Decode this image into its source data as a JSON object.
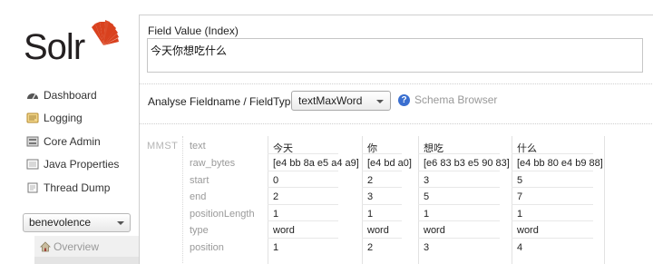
{
  "logo": {
    "wordmark": "Solr"
  },
  "sidebar": {
    "items": [
      {
        "label": "Dashboard",
        "icon": "dashboard-icon"
      },
      {
        "label": "Logging",
        "icon": "logging-icon"
      },
      {
        "label": "Core Admin",
        "icon": "core-admin-icon"
      },
      {
        "label": "Java Properties",
        "icon": "java-properties-icon"
      },
      {
        "label": "Thread Dump",
        "icon": "thread-dump-icon"
      }
    ],
    "core_selector": {
      "value": "benevolence"
    },
    "core_menu": {
      "overview_label": "Overview"
    }
  },
  "analysis": {
    "field_value_label": "Field Value (Index)",
    "field_value": "今天你想吃什么",
    "fieldtype_label": "Analyse Fieldname / FieldType:",
    "fieldtype_value": "textMaxWord",
    "schema_browser_label": "Schema Browser"
  },
  "result": {
    "analyzer": "MMST",
    "row_labels": [
      "text",
      "raw_bytes",
      "start",
      "end",
      "positionLength",
      "type",
      "position"
    ],
    "tokens": [
      {
        "text": "今天",
        "raw_bytes": "[e4 bb 8a e5 a4 a9]",
        "start": "0",
        "end": "2",
        "positionLength": "1",
        "type": "word",
        "position": "1"
      },
      {
        "text": "你",
        "raw_bytes": "[e4 bd a0]",
        "start": "2",
        "end": "3",
        "positionLength": "1",
        "type": "word",
        "position": "2"
      },
      {
        "text": "想吃",
        "raw_bytes": "[e6 83 b3 e5 90 83]",
        "start": "3",
        "end": "5",
        "positionLength": "1",
        "type": "word",
        "position": "3"
      },
      {
        "text": "什么",
        "raw_bytes": "[e4 bb 80 e4 b9 88]",
        "start": "5",
        "end": "7",
        "positionLength": "1",
        "type": "word",
        "position": "4"
      }
    ]
  },
  "colors": {
    "logo_accent": "#d9411e",
    "link_muted": "#999999",
    "help_icon": "#3a6fd0"
  }
}
